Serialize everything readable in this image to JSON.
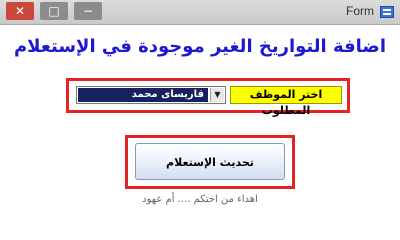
{
  "window": {
    "title": "Form",
    "controls": {
      "close": "✕",
      "maximize": "□",
      "minimize": "−"
    }
  },
  "heading": "اضافة التواريخ الغير موجودة في الإستعلام",
  "employee": {
    "label": "اختر الموظف المطلوب",
    "selected": "قاريساى محمد"
  },
  "update_button_label": "تحديث الإستعلام",
  "footer_note": "اهداء من اختكم .... أم عهود",
  "colors": {
    "heading": "#1f18d3",
    "highlight_frame": "#e42424",
    "label_background": "#ffff00",
    "selected_background": "#17215f"
  }
}
